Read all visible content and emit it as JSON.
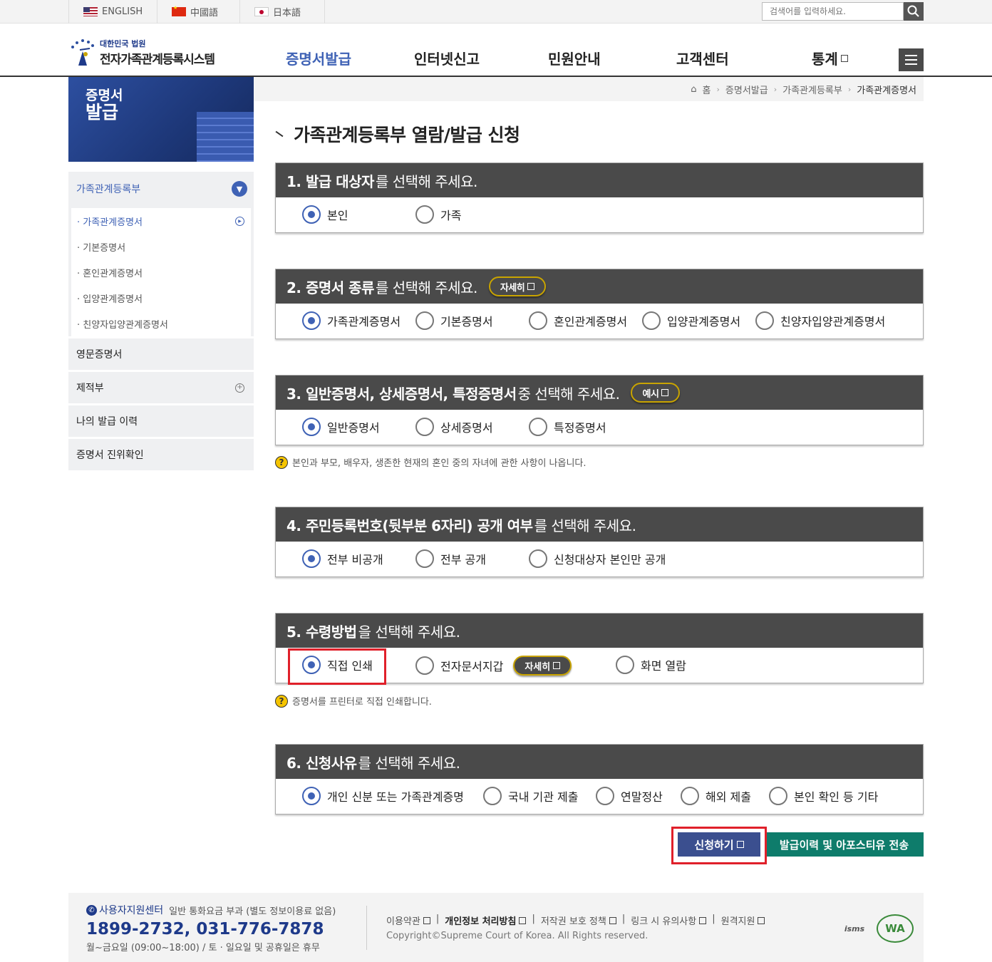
{
  "top": {
    "languages": [
      "ENGLISH",
      "中國語",
      "日本語"
    ],
    "search_placeholder": "검색어를 입력하세요."
  },
  "header": {
    "logo_sub": "대한민국 법원",
    "logo_main": "전자가족관계등록시스템",
    "nav": [
      "증명서발급",
      "인터넷신고",
      "민원안내",
      "고객센터",
      "통계"
    ]
  },
  "visual": {
    "title_line1": "증명서",
    "title_line2": "발급"
  },
  "sidebar": {
    "head": "가족관계등록부",
    "sub": [
      "가족관계증명서",
      "기본증명서",
      "혼인관계증명서",
      "입양관계증명서",
      "친양자입양관계증명서"
    ],
    "items": [
      "영문증명서",
      "제적부",
      "나의 발급 이력",
      "증명서 진위확인"
    ]
  },
  "breadcrumb": [
    "홈",
    "증명서발급",
    "가족관계등록부",
    "가족관계증명서"
  ],
  "page_title": "가족관계등록부 열람/발급 신청",
  "sections": {
    "s1": {
      "bold": "1. 발급 대상자",
      "rest": "를 선택해 주세요.",
      "options": [
        "본인",
        "가족"
      ]
    },
    "s2": {
      "bold": "2. 증명서 종류",
      "rest": "를 선택해 주세요.",
      "pill": "자세히",
      "options": [
        "가족관계증명서",
        "기본증명서",
        "혼인관계증명서",
        "입양관계증명서",
        "친양자입양관계증명서"
      ]
    },
    "s3": {
      "bold": "3. 일반증명서, 상세증명서, 특정증명서",
      "rest": " 중 선택해 주세요.",
      "pill": "예시",
      "options": [
        "일반증명서",
        "상세증명서",
        "특정증명서"
      ],
      "note": "본인과 부모, 배우자, 생존한 현재의 혼인 중의 자녀에 관한 사항이 나옵니다."
    },
    "s4": {
      "bold": "4. 주민등록번호(뒷부분 6자리) 공개 여부",
      "rest": "를 선택해 주세요.",
      "options": [
        "전부 비공개",
        "전부 공개",
        "신청대상자 본인만 공개"
      ]
    },
    "s5": {
      "bold": "5. 수령방법",
      "rest": "을 선택해 주세요.",
      "pill": "자세히",
      "options": [
        "직접 인쇄",
        "전자문서지갑",
        "화면 열람"
      ],
      "note": "증명서를 프린터로 직접 인쇄합니다."
    },
    "s6": {
      "bold": "6. 신청사유",
      "rest": "를 선택해 주세요.",
      "options": [
        "개인 신분 또는 가족관계증명",
        "국내 기관 제출",
        "연말정산",
        "해외 제출",
        "본인 확인 등 기타"
      ]
    }
  },
  "buttons": {
    "apply": "신청하기",
    "transfer": "발급이력 및 아포스티유 전송"
  },
  "footer": {
    "center_title": "사용자지원센터",
    "center_note": "일반 통화요금 부과 (별도 정보이용료 없음)",
    "phone": "1899-2732, 031-776-7878",
    "hours": "월~금요일 (09:00~18:00) / 토 · 일요일 및 공휴일은 휴무",
    "links": [
      "이용약관",
      "개인정보 처리방침",
      "저작권 보호 정책",
      "링크 시 유의사항",
      "원격지원"
    ],
    "copyright": "Copyright©Supreme Court of Korea. All Rights reserved.",
    "badges": [
      "isms",
      "WA"
    ]
  },
  "colors": {
    "accent": "#3f62b5",
    "header_bar": "#4a4a4a",
    "apply_btn": "#3b4f8f",
    "transfer_btn": "#0e7c6b",
    "highlight": "#e0202a"
  }
}
